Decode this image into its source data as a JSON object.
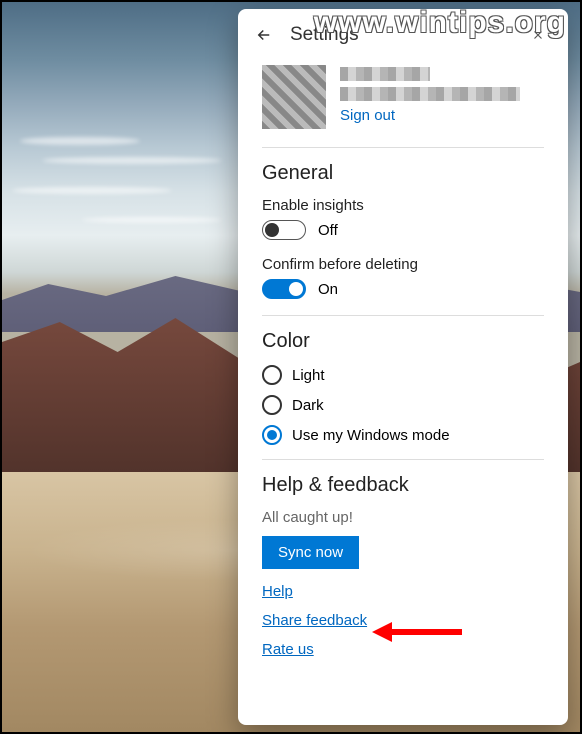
{
  "watermark": "www.wintips.org",
  "header": {
    "title": "Settings"
  },
  "account": {
    "signout": "Sign out"
  },
  "general": {
    "title": "General",
    "insights": {
      "label": "Enable insights",
      "state": "Off",
      "on": false
    },
    "confirm": {
      "label": "Confirm before deleting",
      "state": "On",
      "on": true
    }
  },
  "color": {
    "title": "Color",
    "options": [
      {
        "label": "Light",
        "selected": false
      },
      {
        "label": "Dark",
        "selected": false
      },
      {
        "label": "Use my Windows mode",
        "selected": true
      }
    ]
  },
  "help": {
    "title": "Help & feedback",
    "status": "All caught up!",
    "sync": "Sync now",
    "links": {
      "help": "Help",
      "share": "Share feedback",
      "rate": "Rate us"
    }
  }
}
